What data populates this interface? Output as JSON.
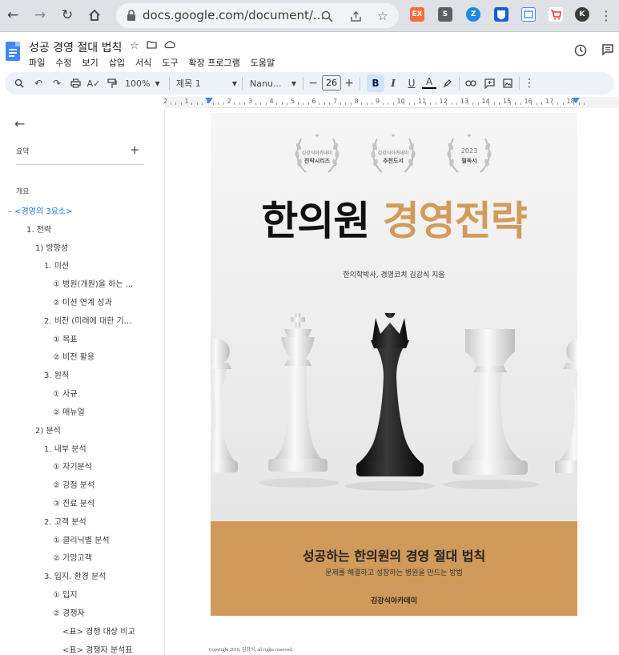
{
  "browser": {
    "url": "docs.google.com/document/...",
    "extensions": [
      {
        "name": "ex-extension-icon",
        "label": "EX",
        "color": "#ff6d3a"
      },
      {
        "name": "s-extension-icon",
        "label": "S",
        "color": "#616161"
      },
      {
        "name": "z-extension-icon",
        "label": "Z",
        "color": "#1e88e5"
      },
      {
        "name": "bitwarden-extension-icon",
        "label": "",
        "color": "#175ddc"
      },
      {
        "name": "translate-extension-icon",
        "label": "",
        "color": "#3f8ef5"
      },
      {
        "name": "cart-extension-icon",
        "label": "",
        "color": "#e53935"
      },
      {
        "name": "k-extension-icon",
        "label": "K",
        "color": "#3a3a3a"
      }
    ]
  },
  "doc": {
    "title": "성공 경영 절대 법칙",
    "menu": [
      "파일",
      "수정",
      "보기",
      "삽입",
      "서식",
      "도구",
      "확장 프로그램",
      "도움말"
    ]
  },
  "toolbar": {
    "zoom": "100%",
    "style": "제목 1",
    "font": "Nanu...",
    "font_size": "26",
    "bold": "B",
    "italic": "I",
    "underline": "U",
    "text_color": "A"
  },
  "ruler": {
    "numbers": [
      "2",
      "1",
      "1",
      "2",
      "3",
      "4",
      "5",
      "6",
      "7",
      "8",
      "9",
      "10",
      "11",
      "12",
      "13",
      "14",
      "15",
      "16",
      "17",
      "18"
    ]
  },
  "outline": {
    "summary_label": "요약",
    "outline_label": "개요",
    "items": [
      "– <경영의 3요소>",
      "1. 전략",
      "1) 방향성",
      "1. 미션",
      "① 병원(개원)을 하는 ...",
      "② 미션 연계 성과",
      "2. 비전 (미래에 대한 기...",
      "① 목표",
      "② 비전 활용",
      "3. 원칙",
      "① 사규",
      "② 매뉴얼",
      "2) 분석",
      "1. 내부 분석",
      "① 자기분석",
      "② 강점 분석",
      "③ 진료 분석",
      "2. 고객 분석",
      "① 클리닉별 분석",
      "② 가망고객",
      "3. 입지. 환경 분석",
      "① 입지",
      "② 경쟁자",
      "<표> 경쟁 대상 비교",
      "<표> 경쟁자 분석표"
    ]
  },
  "cover": {
    "badges": [
      {
        "line1": "김강식아카데미",
        "line2": "전략시리즈"
      },
      {
        "line1": "김강식아카데미",
        "line2": "추천도서"
      },
      {
        "line1": "2023",
        "line2": "필독서"
      }
    ],
    "title_dark": "한의원",
    "title_accent": "경영전략",
    "author": "한의학박사, 경영코치 김강식 지음",
    "subtitle": "성공하는 한의원의 경영 절대 법칙",
    "tagline": "문제를 해결하고 성장하는 병원을 만드는 방법",
    "publisher": "김강식아카데미",
    "accent_color": "#cf9a5a"
  },
  "copyright": "Copyright 2018, 김강식, all rights reserved."
}
